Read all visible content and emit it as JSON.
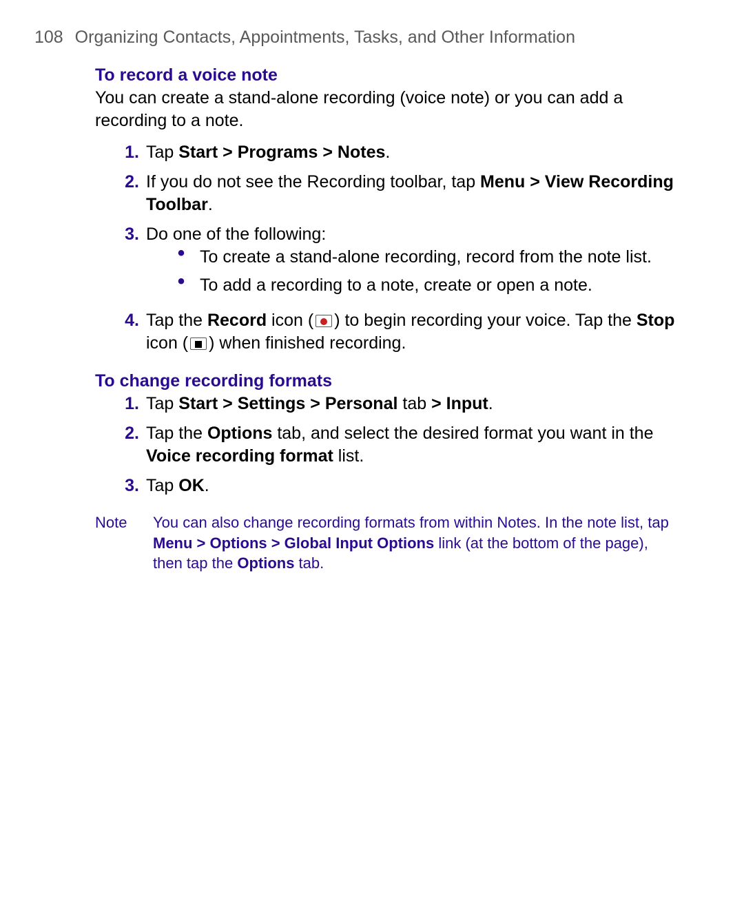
{
  "header": {
    "page_number": "108",
    "title": "Organizing Contacts, Appointments, Tasks, and Other Information"
  },
  "section1": {
    "title": "To record a voice note",
    "intro": "You can create a stand-alone recording (voice note) or you can add a recording to a note.",
    "step1_num": "1.",
    "step1_a": "Tap ",
    "step1_b": "Start > Programs > Notes",
    "step1_c": ".",
    "step2_num": "2.",
    "step2_a": "If you do not see the Recording toolbar, tap ",
    "step2_b": "Menu > View Recording Toolbar",
    "step2_c": ".",
    "step3_num": "3.",
    "step3_a": "Do one of the following:",
    "step3_b1": "To create a stand-alone recording, record from the note list.",
    "step3_b2": "To add a recording to a note, create or open a note.",
    "step4_num": "4.",
    "step4_a": "Tap the ",
    "step4_b": "Record",
    "step4_c": " icon (",
    "step4_d": ") to begin recording your voice. Tap the ",
    "step4_e": "Stop",
    "step4_f": " icon (",
    "step4_g": ") when finished recording."
  },
  "section2": {
    "title": "To change recording formats",
    "step1_num": "1.",
    "step1_a": "Tap ",
    "step1_b": "Start > Settings > Personal",
    "step1_c": " tab ",
    "step1_d": "> Input",
    "step1_e": ".",
    "step2_num": "2.",
    "step2_a": "Tap the ",
    "step2_b": "Options",
    "step2_c": " tab, and select the desired format you want in the ",
    "step2_d": "Voice recording format",
    "step2_e": " list.",
    "step3_num": "3.",
    "step3_a": "Tap ",
    "step3_b": "OK",
    "step3_c": "."
  },
  "note": {
    "label": "Note",
    "a": "You can also change recording formats from within Notes. In the note list, tap ",
    "b": "Menu > Options > Global Input Options",
    "c": " link (at the bottom of the page), then tap the ",
    "d": "Options",
    "e": " tab."
  }
}
